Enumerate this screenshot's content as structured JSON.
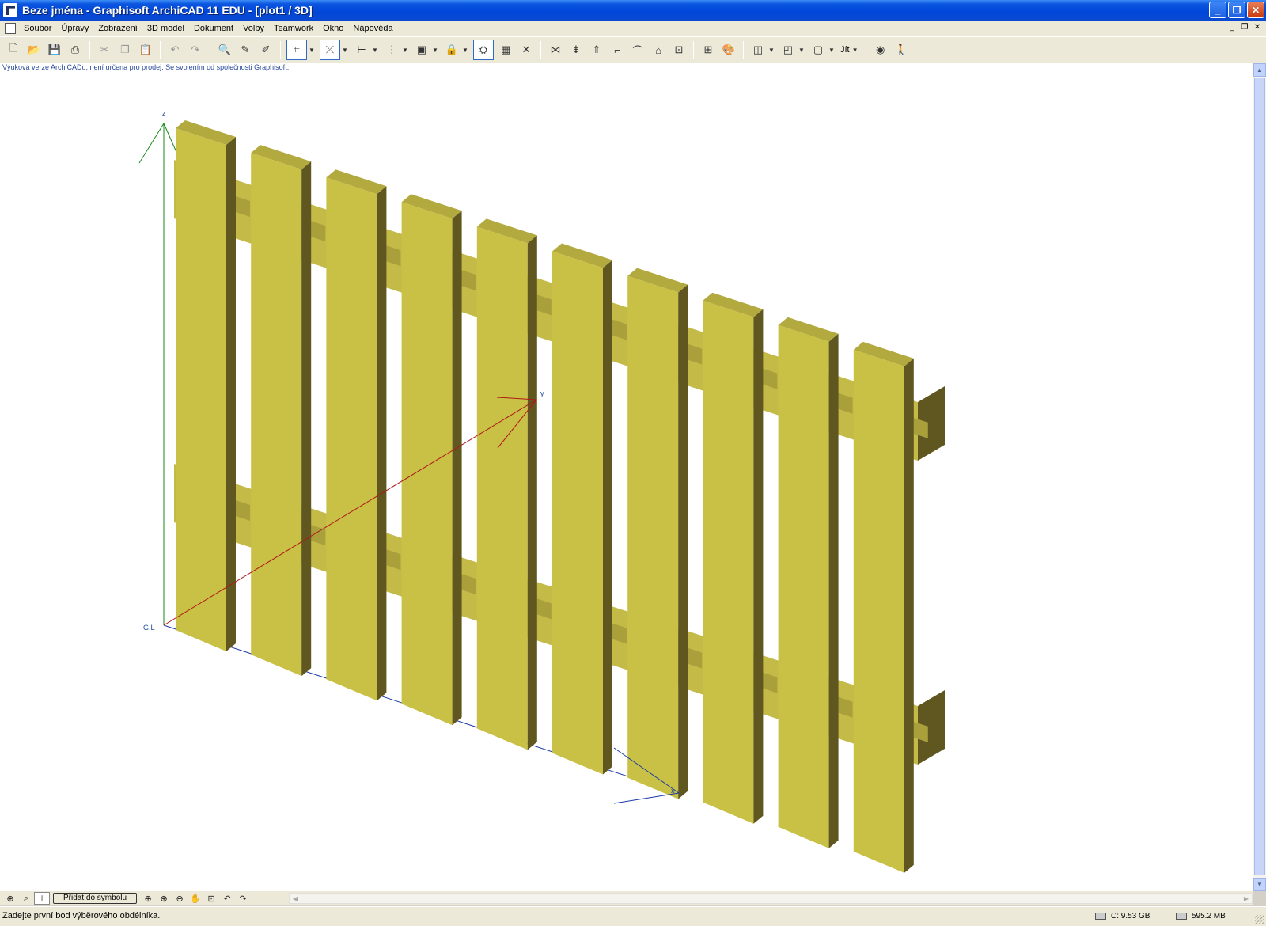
{
  "window": {
    "title": "Beze jména - Graphisoft ArchiCAD 11 EDU - [plot1 / 3D]",
    "buttons": {
      "minimize": "_",
      "maximize": "❐",
      "close": "✕"
    }
  },
  "menu": {
    "items": [
      "Soubor",
      "Úpravy",
      "Zobrazení",
      "3D model",
      "Dokument",
      "Volby",
      "Teamwork",
      "Okno",
      "Nápověda"
    ],
    "mdi_buttons": {
      "minimize": "_",
      "restore": "❐",
      "close": "✕"
    }
  },
  "toolbar": {
    "go_label": "Jít",
    "icons": [
      "new-icon",
      "open-icon",
      "save-icon",
      "print-icon",
      "cut-icon",
      "copy-icon",
      "paste-icon",
      "undo-icon",
      "redo-icon",
      "find-select-icon",
      "pick-up-icon",
      "inject-icon",
      "marquee-icon",
      "arrow-icon",
      "align-icon",
      "distribute-icon",
      "group-icon",
      "lock-icon",
      "3d-window-icon",
      "section-icon",
      "delete-icon",
      "split-icon",
      "adjust-icon",
      "elevate-icon",
      "fillet-icon",
      "curve-icon",
      "trim-icon",
      "explode-icon",
      "grid-icon",
      "render-icon",
      "plan-view-icon",
      "3d-view-icon",
      "window-icon",
      "navigator-icon",
      "walk-icon"
    ]
  },
  "viewport": {
    "notice": "Výuková verze ArchiCADu, není určena pro prodej. Se svolením od společnosti Graphisoft.",
    "axes": {
      "z": "z",
      "y": "y",
      "x": "x",
      "origin_label": "G.L"
    },
    "colors": {
      "picket_face": "#c9c145",
      "picket_top": "#b3aa3f",
      "picket_side": "#5f5620",
      "rail_face": "#c4ba48",
      "rail_bottom": "#a9a03c",
      "rail_end": "#5f5620",
      "axis_z": "#1a8a1a",
      "axis_y": "#b01818",
      "axis_x": "#1a3aa8",
      "axis_label": "#1a4a9a"
    },
    "picket_count": 10
  },
  "navigation": {
    "add_to_symbol": "Přidat do symbolu"
  },
  "status": {
    "message": "Zadejte první bod výběrového obdélníka.",
    "disk": "C: 9.53 GB",
    "memory": "595.2 MB"
  }
}
